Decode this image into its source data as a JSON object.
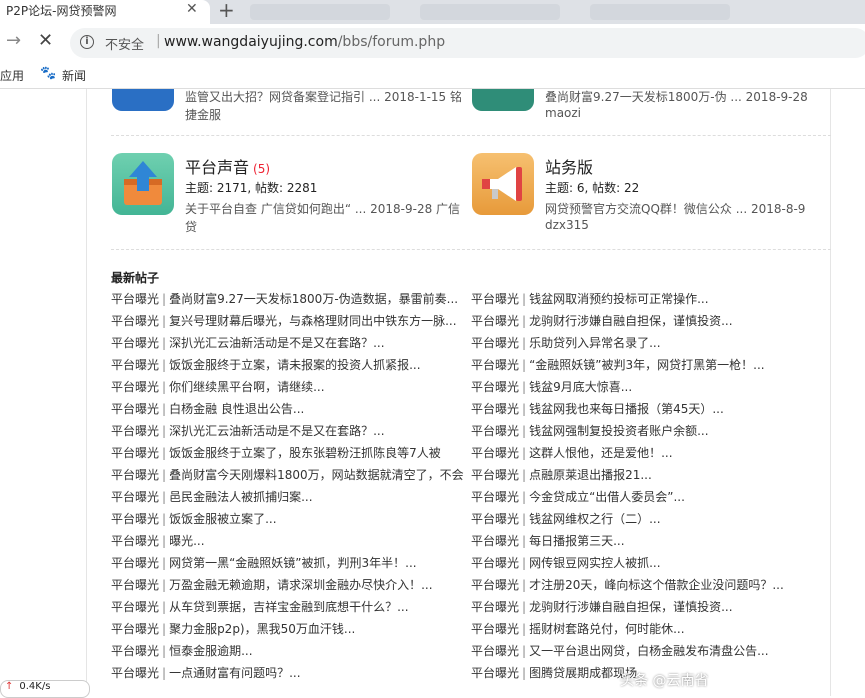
{
  "browser": {
    "tab_title": "P2P论坛-网贷预警网",
    "tab_close": "✕",
    "new_tab": "+",
    "security_label": "不安全",
    "url_domain": "www.wangdaiyujing.com",
    "url_path": "/bbs/forum.php",
    "bookmarks": [
      "应用",
      "新闻"
    ]
  },
  "forums_top": [
    {
      "last_post": "监管又出大招？网贷备案登记指引 ... 2018-1-15 铭",
      "last_post2": "捷金服"
    },
    {
      "last_post": "叠尚财富9.27一天发标1800万-伪 ... 2018-9-28",
      "last_post2": "maozi"
    }
  ],
  "forums": [
    {
      "name": "平台声音",
      "count": "(5)",
      "stats": "主题: 2171, 帖数: 2281",
      "last_post": "关于平台自查 广信贷如何跑出“ ... 2018-9-28 广信",
      "last_post2": "贷",
      "icon": "upload-box-icon"
    },
    {
      "name": "站务版",
      "count": "",
      "stats": "主题: 6, 帖数: 22",
      "last_post": "网贷预警官方交流QQ群！微信公众 ... 2018-8-9",
      "last_post2": "dzx315",
      "icon": "megaphone-icon"
    }
  ],
  "latest": {
    "title": "最新帖子",
    "left": [
      {
        "cat": "平台曝光",
        "text": "叠尚财富9.27一天发标1800万-伪造数据，暴雷前奏..."
      },
      {
        "cat": "平台曝光",
        "text": "复兴号理财幕后曝光，与森格理财同出中铁东方一脉..."
      },
      {
        "cat": "平台曝光",
        "text": "深扒光汇云油新活动是不是又在套路？..."
      },
      {
        "cat": "平台曝光",
        "text": "饭饭金服终于立案，请未报案的投资人抓紧报..."
      },
      {
        "cat": "平台曝光",
        "text": "你们继续黑平台啊，请继续..."
      },
      {
        "cat": "平台曝光",
        "text": "白杨金融 良性退出公告..."
      },
      {
        "cat": "平台曝光",
        "text": "深扒光汇云油新活动是不是又在套路？..."
      },
      {
        "cat": "平台曝光",
        "text": "饭饭金服终于立案了，股东张碧粉汪抓陈良等7人被"
      },
      {
        "cat": "平台曝光",
        "text": "叠尚财富今天刚爆料1800万，网站数据就清空了，不会"
      },
      {
        "cat": "平台曝光",
        "text": "邑民金融法人被抓捕归案..."
      },
      {
        "cat": "平台曝光",
        "text": "饭饭金服被立案了..."
      },
      {
        "cat": "平台曝光",
        "text": "曝光..."
      },
      {
        "cat": "平台曝光",
        "text": "网贷第一黑“金融照妖镜”被抓，判刑3年半！..."
      },
      {
        "cat": "平台曝光",
        "text": "万盈金融无赖逾期，请求深圳金融办尽快介入！..."
      },
      {
        "cat": "平台曝光",
        "text": "从车贷到票据，吉祥宝金融到底想干什么？..."
      },
      {
        "cat": "平台曝光",
        "text": "聚力金服p2p)，黑我50万血汗钱..."
      },
      {
        "cat": "平台曝光",
        "text": "恒泰金服逾期..."
      },
      {
        "cat": "平台曝光",
        "text": "一点通财富有问题吗？..."
      }
    ],
    "right": [
      {
        "cat": "平台曝光",
        "text": "钱盆网取消预约投标可正常操作..."
      },
      {
        "cat": "平台曝光",
        "text": "龙驹财行涉嫌自融自担保，谨慎投资..."
      },
      {
        "cat": "平台曝光",
        "text": "乐助贷列入异常名录了..."
      },
      {
        "cat": "平台曝光",
        "text": "“金融照妖镜”被判3年，网贷打黑第一枪！..."
      },
      {
        "cat": "平台曝光",
        "text": "钱盆9月底大惊喜..."
      },
      {
        "cat": "平台曝光",
        "text": "钱盆网我也来每日播报（第45天）..."
      },
      {
        "cat": "平台曝光",
        "text": "钱盆网强制复投投资者账户余额..."
      },
      {
        "cat": "平台曝光",
        "text": "这群人恨他，还是爱他！..."
      },
      {
        "cat": "平台曝光",
        "text": "点融原莱退出播报21..."
      },
      {
        "cat": "平台曝光",
        "text": "今金贷成立“出借人委员会”..."
      },
      {
        "cat": "平台曝光",
        "text": "钱盆网维权之行（二）..."
      },
      {
        "cat": "平台曝光",
        "text": "每日播报第三天..."
      },
      {
        "cat": "平台曝光",
        "text": "网传银豆网实控人被抓..."
      },
      {
        "cat": "平台曝光",
        "text": "才注册20天，峰向标这个借款企业没问题吗？..."
      },
      {
        "cat": "平台曝光",
        "text": "龙驹财行涉嫌自融自担保，谨慎投资..."
      },
      {
        "cat": "平台曝光",
        "text": "摇财树套路兑付，何时能休..."
      },
      {
        "cat": "平台曝光",
        "text": "又一平台退出网贷，白杨金融发布清盘公告..."
      },
      {
        "cat": "平台曝光",
        "text": "图腾贷展期成都现场"
      }
    ]
  },
  "status": {
    "speed": "0.4K/s",
    "up_arrow": "↑"
  },
  "watermark": "头条 @云南省"
}
